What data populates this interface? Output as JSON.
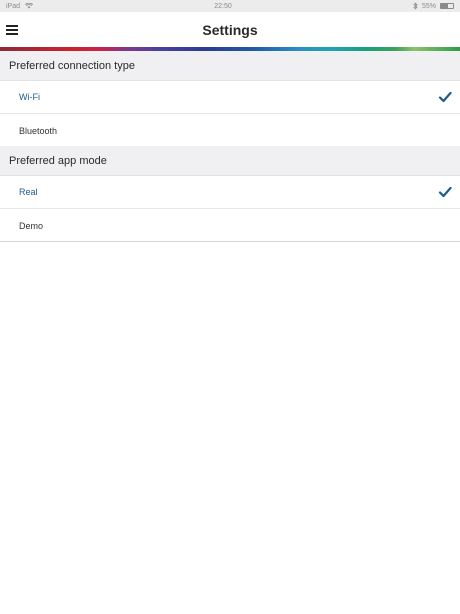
{
  "status_bar": {
    "device": "iPad",
    "wifi_icon": "wifi-icon",
    "time": "22:50",
    "bluetooth_icon": "bluetooth-icon",
    "battery_text": "55%",
    "battery_level": 0.55
  },
  "header": {
    "title": "Settings",
    "menu_icon": "hamburger-menu-icon"
  },
  "sections": [
    {
      "title": "Preferred connection type",
      "options": [
        {
          "label": "Wi-Fi",
          "selected": true
        },
        {
          "label": "Bluetooth",
          "selected": false
        }
      ]
    },
    {
      "title": "Preferred app mode",
      "options": [
        {
          "label": "Real",
          "selected": true
        },
        {
          "label": "Demo",
          "selected": false
        }
      ]
    }
  ],
  "colors": {
    "selected_text": "#1f5a8c",
    "checkmark": "#1f5a8c",
    "section_background": "#f0f0f2"
  }
}
